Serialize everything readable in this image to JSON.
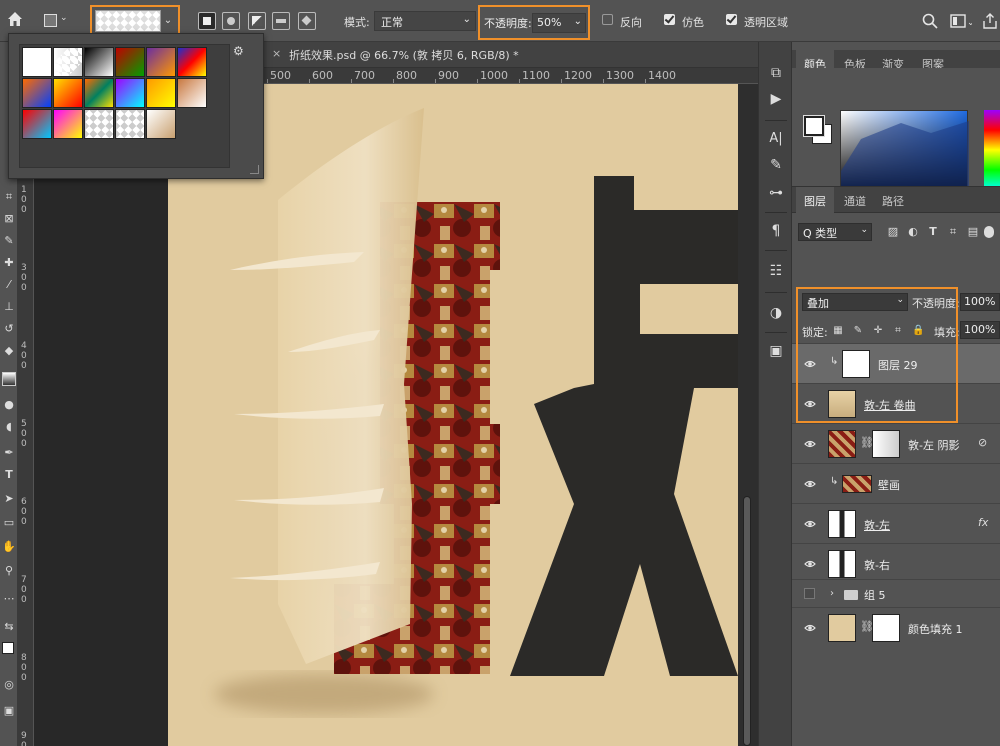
{
  "options_bar": {
    "mode_label": "模式:",
    "mode_value": "正常",
    "opacity_label": "不透明度:",
    "opacity_value": "50%",
    "reverse_label": "反向",
    "dither_label": "仿色",
    "transparency_label": "透明区域",
    "reverse_checked": false,
    "dither_checked": true,
    "transparency_checked": true
  },
  "document": {
    "tab_title": "折纸效果.psd @ 66.7% (敦 拷贝 6, RGB/8) *",
    "close_glyph": "×",
    "h_ruler": [
      "500",
      "600",
      "700",
      "800",
      "900",
      "1000",
      "1100",
      "1200",
      "1300",
      "1400"
    ],
    "v_ruler": [
      "1|0|0",
      "3|0|0",
      "4|0|0",
      "5|0|0",
      "6|0|0",
      "7|0|0",
      "8|0|0",
      "9|0|0"
    ]
  },
  "gradient_presets": [
    "#ffffff",
    "checker-fade",
    "#000000-#ffffff",
    "#c00000-#00a000",
    "#6a2ea0-#ff9900",
    "#1a30d0-#ff0000-#ffff00",
    "#ff6a00-#0040ff",
    "#ffe000-#ff0000",
    "#ff6a00-#008060-#ffe000",
    "#a000ff-#00ffff",
    "#ff9900-#ffff00",
    "#c87840-#ffffff",
    "#ff0000-#00c8ff",
    "#ff00ff-#ffff00",
    "checker",
    "checker2",
    "#ffffff-#c8a070"
  ],
  "color_panel": {
    "tabs": [
      "颜色",
      "色板",
      "渐变",
      "图案"
    ],
    "active_tab": 0,
    "fg_color": "#ffffff",
    "bg_color": "#ffffff"
  },
  "layers_panel": {
    "tabs": [
      "图层",
      "通道",
      "路径"
    ],
    "active_tab": 0,
    "filter_label": "Q 类型",
    "blend_mode": "叠加",
    "opacity_label": "不透明度:",
    "opacity_value": "100%",
    "lock_label": "锁定:",
    "fill_label": "填充:",
    "fill_value": "100%",
    "layers": [
      {
        "name": "图层 29",
        "visible": true,
        "selected": true,
        "clip": true,
        "underline": false,
        "thumb": "white",
        "fx": false
      },
      {
        "name": "敦-左 卷曲",
        "visible": true,
        "selected": false,
        "clip": false,
        "underline": true,
        "thumb": "beige-smart",
        "fx": false
      },
      {
        "name": "敦-左 阴影",
        "visible": true,
        "selected": false,
        "clip": false,
        "underline": false,
        "thumb": "mural-mask",
        "fx": false
      },
      {
        "name": "壁画",
        "visible": true,
        "selected": false,
        "clip": true,
        "underline": false,
        "thumb": "mural",
        "fx": false
      },
      {
        "name": "敦-左",
        "visible": true,
        "selected": false,
        "clip": false,
        "underline": true,
        "thumb": "glyph",
        "fx": true
      },
      {
        "name": "敦-右",
        "visible": true,
        "selected": false,
        "clip": false,
        "underline": false,
        "thumb": "glyph",
        "fx": false
      },
      {
        "name": "组 5",
        "visible": false,
        "selected": false,
        "clip": false,
        "underline": false,
        "thumb": "folder",
        "fx": false
      },
      {
        "name": "颜色填充 1",
        "visible": true,
        "selected": false,
        "clip": false,
        "underline": false,
        "thumb": "fill",
        "fx": false
      }
    ]
  },
  "colors": {
    "highlight": "#f0902a",
    "canvas_bg": "#e1cb9f",
    "glyph_dark": "#2b2a28",
    "mural_red": "#8a1d14"
  }
}
